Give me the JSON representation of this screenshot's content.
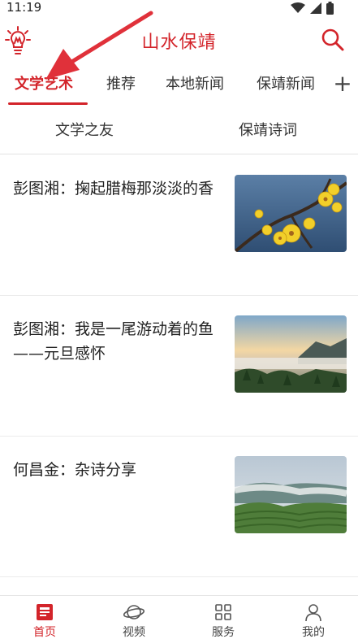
{
  "status_bar": {
    "time": "11:19"
  },
  "header": {
    "brand": "山水保靖",
    "logo_icon": "lightbulb-icon",
    "search_icon": "search-icon"
  },
  "channels": [
    {
      "label": "文学艺术",
      "active": true
    },
    {
      "label": "推荐",
      "active": false
    },
    {
      "label": "本地新闻",
      "active": false
    },
    {
      "label": "保靖新闻",
      "active": false
    }
  ],
  "add_channel_label": "+",
  "sub_tabs": [
    {
      "label": "文学之友"
    },
    {
      "label": "保靖诗词"
    }
  ],
  "articles": [
    {
      "title": "彭图湘：掬起腊梅那淡淡的香",
      "thumb": "wintersweet-flowers"
    },
    {
      "title": "彭图湘：我是一尾游动着的鱼——元旦感怀",
      "thumb": "mountain-sea-of-clouds"
    },
    {
      "title": "何昌金：杂诗分享",
      "thumb": "misty-mountain-tea-fields"
    }
  ],
  "bottom_nav": [
    {
      "label": "首页",
      "icon": "home-news-icon",
      "active": true
    },
    {
      "label": "视频",
      "icon": "planet-icon",
      "active": false
    },
    {
      "label": "服务",
      "icon": "grid-icon",
      "active": false
    },
    {
      "label": "我的",
      "icon": "user-icon",
      "active": false
    }
  ],
  "colors": {
    "accent": "#d3242a",
    "text": "#222222",
    "divider": "#e2e2e2"
  }
}
